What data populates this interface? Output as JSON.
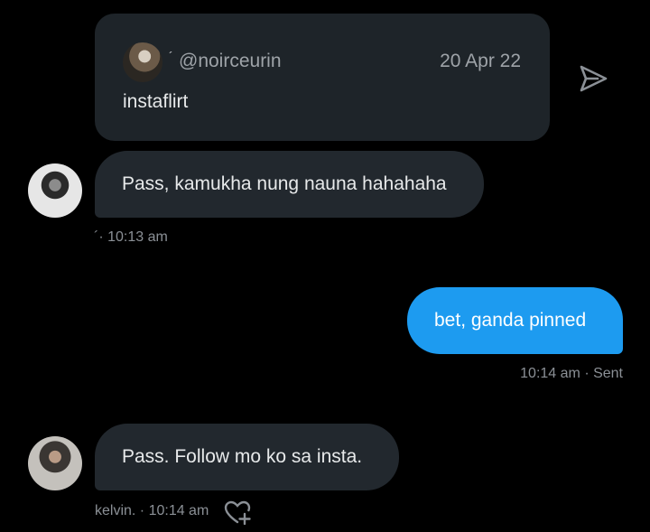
{
  "quoted_tweet": {
    "badge": "´",
    "handle": "@noirceurin",
    "date": "20 Apr 22",
    "text": "instaflirt"
  },
  "messages": [
    {
      "direction": "received",
      "text": "Pass, kamukha nung nauna hahahaha",
      "meta": "´· 10:13 am"
    },
    {
      "direction": "sent",
      "text": "bet, ganda pinned",
      "meta": "10:14 am · Sent"
    },
    {
      "direction": "received",
      "text": "Pass. Follow mo ko sa insta.",
      "meta": "kelvin. · 10:14 am"
    }
  ],
  "colors": {
    "background": "#000000",
    "received_bubble": "#22282e",
    "sent_bubble": "#1d9bf0",
    "meta_text": "#8b9096"
  },
  "icons": {
    "share": "share-send-icon",
    "react": "heart-add-icon"
  }
}
